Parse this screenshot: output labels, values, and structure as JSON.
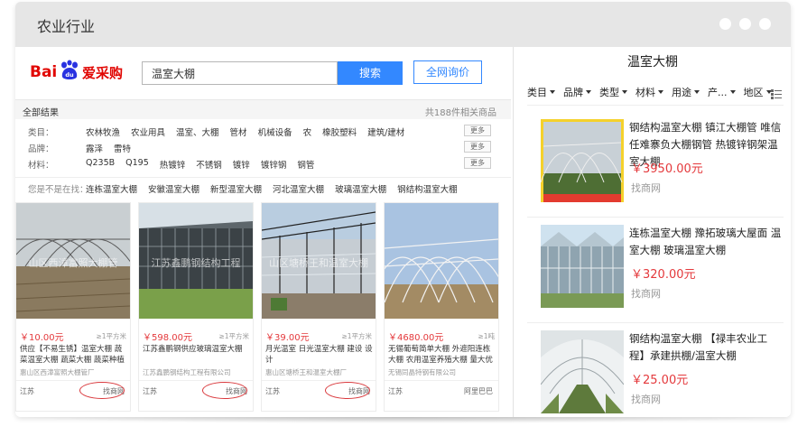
{
  "window": {
    "title": "农业行业"
  },
  "left": {
    "logo": {
      "bai": "Bai",
      "du": "du",
      "ai": "爱采购"
    },
    "search": {
      "query": "温室大棚",
      "button": "搜索",
      "quote_button": "全网询价"
    },
    "results": {
      "all_label": "全部结果",
      "count": "共188件相关商品"
    },
    "filters": [
      {
        "label": "类目：",
        "items": [
          "农林牧渔",
          "农业用具",
          "温室、大棚",
          "管材",
          "机械设备",
          "农",
          "橡胶塑料",
          "建筑/建材"
        ],
        "more": "更多"
      },
      {
        "label": "品牌：",
        "items": [
          "露泽",
          "雷特"
        ],
        "more": "更多"
      },
      {
        "label": "材料：",
        "items": [
          "Q235B",
          "Q195",
          "热镀锌",
          "不锈钢",
          "镀锌",
          "镀锌钢",
          "钢管"
        ],
        "more": "更多"
      }
    ],
    "also": {
      "label": "您是不是在找：",
      "items": [
        "连栋温室大棚",
        "安徽温室大棚",
        "新型温室大棚",
        "河北温室大棚",
        "玻璃温室大棚",
        "钢结构温室大棚"
      ]
    },
    "cards": [
      {
        "price": "￥10.00元",
        "unit": "≥1平方米",
        "desc": "供应【不易生锈】温室大棚 蔬菜温室大棚 蔬菜大棚 蔬菜种植大棚",
        "company": "惠山区西漳富照大棚管厂",
        "loc": "江苏",
        "src": "找商网",
        "watermark": "山区西漳富照大棚管"
      },
      {
        "price": "￥598.00元",
        "unit": "≥1平方米",
        "desc": "江苏鑫鹏钢供应玻璃温室大棚",
        "company": "江苏鑫鹏钢结构工程有限公司",
        "loc": "江苏",
        "src": "找商网",
        "watermark": "江苏鑫鹏钢结构工程"
      },
      {
        "price": "￥39.00元",
        "unit": "≥1平方米",
        "desc": "月光温室 日光温室大棚 建设 设计",
        "company": "惠山区塘桥王和温室大棚厂",
        "loc": "江苏",
        "src": "找商网",
        "watermark": "山区塘桥王和温室大棚"
      },
      {
        "price": "￥4680.00元",
        "unit": "≥1吨",
        "desc": "无锡葡萄简单大棚 外遮阳连栋大棚 农用温室养殖大棚 量大优惠",
        "company": "无锡同晶特钢有限公司",
        "loc": "江苏",
        "src": "阿里巴巴",
        "watermark": ""
      }
    ]
  },
  "right": {
    "title": "温室大棚",
    "filters": [
      "类目",
      "品牌",
      "类型",
      "材料",
      "用途",
      "产...",
      "地区"
    ],
    "items": [
      {
        "title": "钢结构温室大棚 镇江大棚管 唯信任难寨负大棚钢管 热镀锌钢架温室大棚",
        "price": "￥3950.00元",
        "source": "找商网"
      },
      {
        "title": "连栋温室大棚 豫拓玻璃大屋面 温室大棚 玻璃温室大棚",
        "price": "￥320.00元",
        "source": "找商网"
      },
      {
        "title": "钢结构温室大棚 【禄丰农业工程】承建拱棚/温室大棚",
        "price": "￥25.00元",
        "source": "找商网"
      }
    ]
  },
  "colors": {
    "accent": "#3388ff",
    "price": "#e4393c",
    "brand": "#e10602",
    "circle": "#d9373b"
  }
}
